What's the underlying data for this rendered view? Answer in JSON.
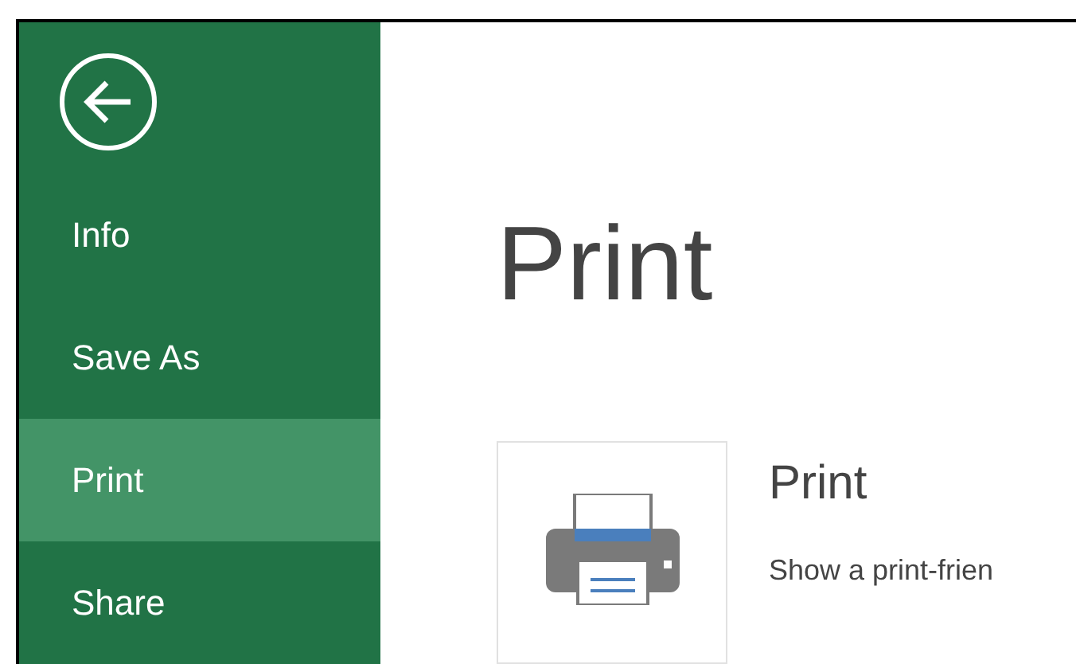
{
  "sidebar": {
    "items": [
      {
        "label": "Info",
        "selected": false
      },
      {
        "label": "Save As",
        "selected": false
      },
      {
        "label": "Print",
        "selected": true
      },
      {
        "label": "Share",
        "selected": false
      }
    ]
  },
  "page": {
    "title": "Print"
  },
  "options": [
    {
      "title": "Print",
      "description": "Show a print-frien"
    }
  ]
}
